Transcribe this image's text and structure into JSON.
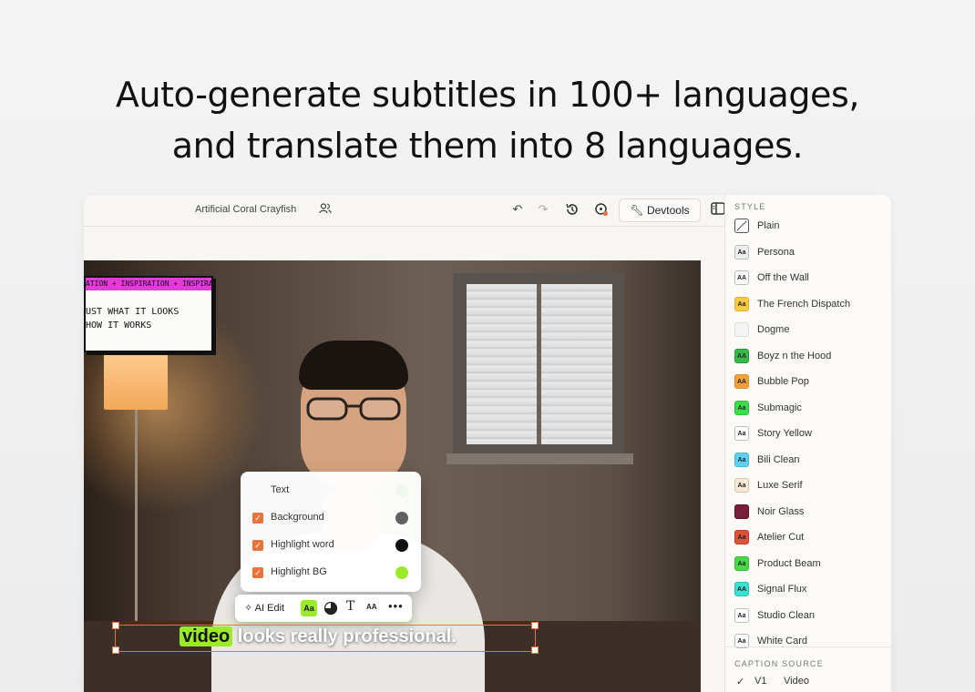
{
  "headline": {
    "line1": "Auto-generate subtitles in 100+ languages,",
    "line2": "and translate them into 8 languages."
  },
  "toolbar": {
    "project_name": "Artificial Coral Crayfish",
    "devtools_label": "Devtools"
  },
  "lower_third": {
    "ticker": "ATION + INSPIRATION + INSPIRATION + IN",
    "line1": "UST WHAT IT LOOKS",
    "line2": " HOW IT WORKS"
  },
  "color_menu": {
    "items": [
      {
        "label": "Text",
        "checked": false,
        "color": "#eef8ee"
      },
      {
        "label": "Background",
        "checked": true,
        "color": "#5f6163"
      },
      {
        "label": "Highlight word",
        "checked": true,
        "color": "#111111"
      },
      {
        "label": "Highlight BG",
        "checked": true,
        "color": "#9bea2a"
      }
    ]
  },
  "edit_bar": {
    "ai_edit_label": "AI Edit",
    "aa_label": "Aa",
    "text_label": "T",
    "caps_label": "AA",
    "more_label": "•••"
  },
  "subtitle": {
    "highlight_word": "video",
    "rest": " looks really professional."
  },
  "sidebar": {
    "style_heading": "STYLE",
    "styles": [
      {
        "label": "Plain",
        "swatch_text": "",
        "swatch_bg": "#ffffff",
        "swatch_border": "#555555"
      },
      {
        "label": "Persona",
        "swatch_text": "Aa",
        "swatch_bg": "#eeeeee",
        "swatch_border": "#bbbbbb"
      },
      {
        "label": "Off the Wall",
        "swatch_text": "AA",
        "swatch_bg": "#ffffff",
        "swatch_border": "#bbbbbb"
      },
      {
        "label": "The French Dispatch",
        "swatch_text": "Aa",
        "swatch_bg": "#f6c948",
        "swatch_border": "#e0b030"
      },
      {
        "label": "Dogme",
        "swatch_text": "",
        "swatch_bg": "#f4f4f4",
        "swatch_border": "#dddddd"
      },
      {
        "label": "Boyz n the Hood",
        "swatch_text": "AA",
        "swatch_bg": "#35b94a",
        "swatch_border": "#2a9a3a"
      },
      {
        "label": "Bubble Pop",
        "swatch_text": "AA",
        "swatch_bg": "#f2a23a",
        "swatch_border": "#d98a25"
      },
      {
        "label": "Submagic",
        "swatch_text": "Aa",
        "swatch_bg": "#3ddc4a",
        "swatch_border": "#2cc03a"
      },
      {
        "label": "Story Yellow",
        "swatch_text": "Aa",
        "swatch_bg": "#ffffff",
        "swatch_border": "#bbbbbb"
      },
      {
        "label": "Bili Clean",
        "swatch_text": "Aa",
        "swatch_bg": "#5fd0f2",
        "swatch_border": "#3fb8de"
      },
      {
        "label": "Luxe Serif",
        "swatch_text": "Aa",
        "swatch_bg": "#f4ead8",
        "swatch_border": "#d8c8a8"
      },
      {
        "label": "Noir Glass",
        "swatch_text": "",
        "swatch_bg": "#7a1f3a",
        "swatch_border": "#5a1028"
      },
      {
        "label": "Atelier Cut",
        "swatch_text": "Aa",
        "swatch_bg": "#e0503a",
        "swatch_border": "#c03a28"
      },
      {
        "label": "Product Beam",
        "swatch_text": "Aa",
        "swatch_bg": "#4ad84a",
        "swatch_border": "#35be35"
      },
      {
        "label": "Signal Flux",
        "swatch_text": "AA",
        "swatch_bg": "#3ae0d0",
        "swatch_border": "#25c0b0"
      },
      {
        "label": "Studio Clean",
        "swatch_text": "Aa",
        "swatch_bg": "#ffffff",
        "swatch_border": "#bbbbbb"
      },
      {
        "label": "White Card",
        "swatch_text": "Aa",
        "swatch_bg": "#ffffff",
        "swatch_border": "#bbbbbb"
      }
    ],
    "caption_source_heading": "CAPTION SOURCE",
    "caption_source": {
      "check": "✓",
      "version": "V1",
      "label": "Video"
    }
  },
  "colors": {
    "accent_orange": "#e8743b",
    "highlight_green": "#9bea2a",
    "ticker_magenta": "#e33bd9"
  }
}
